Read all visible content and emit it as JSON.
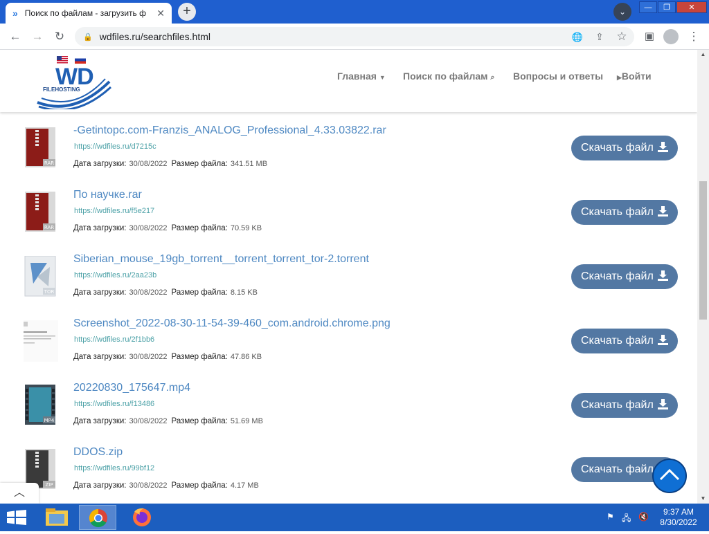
{
  "browser": {
    "tab_title": "Поиск по файлам - загрузить ф",
    "tab_close": "✕",
    "new_tab": "+",
    "url": "wdfiles.ru/searchfiles.html"
  },
  "site": {
    "logo_text": "WD",
    "logo_sub": "FILEHOSTING",
    "nav": [
      "Главная",
      "Поиск по файлам",
      "Вопросы и ответы",
      "Войти"
    ]
  },
  "labels": {
    "upload_date": "Дата загрузки:",
    "file_size": "Размер файла:",
    "download": "Скачать файл"
  },
  "files": [
    {
      "name": "-Getintopc.com-Franzis_ANALOG_Professional_4.33.03822.rar",
      "url": "https://wdfiles.ru/d7215c",
      "date": "30/08/2022",
      "size": "341.51 MB",
      "icon": "rar-file-icon",
      "ext": "RAR"
    },
    {
      "name": "По научке.rar",
      "url": "https://wdfiles.ru/f5e217",
      "date": "30/08/2022",
      "size": "70.59 KB",
      "icon": "rar-file-icon",
      "ext": "RAR"
    },
    {
      "name": "Siberian_mouse_19gb_torrent__torrent_torrent_tor-2.torrent",
      "url": "https://wdfiles.ru/2aa23b",
      "date": "30/08/2022",
      "size": "8.15 KB",
      "icon": "torrent-file-icon",
      "ext": "TOR"
    },
    {
      "name": "Screenshot_2022-08-30-11-54-39-460_com.android.chrome.png",
      "url": "https://wdfiles.ru/2f1bb6",
      "date": "30/08/2022",
      "size": "47.86 KB",
      "icon": "image-thumbnail",
      "ext": ""
    },
    {
      "name": "20220830_175647.mp4",
      "url": "https://wdfiles.ru/f13486",
      "date": "30/08/2022",
      "size": "51.69 MB",
      "icon": "video-file-icon",
      "ext": "MP4"
    },
    {
      "name": "DDOS.zip",
      "url": "https://wdfiles.ru/99bf12",
      "date": "30/08/2022",
      "size": "4.17 MB",
      "icon": "zip-file-icon",
      "ext": "ZIP"
    }
  ],
  "thumbnail_text": {
    "line1": "Страница недоступна"
  },
  "taskbar": {
    "time": "9:37 AM",
    "date": "8/30/2022"
  },
  "colors": {
    "link": "#4e88c2",
    "button": "#5378a3",
    "taskbar": "#1c5ebf"
  }
}
